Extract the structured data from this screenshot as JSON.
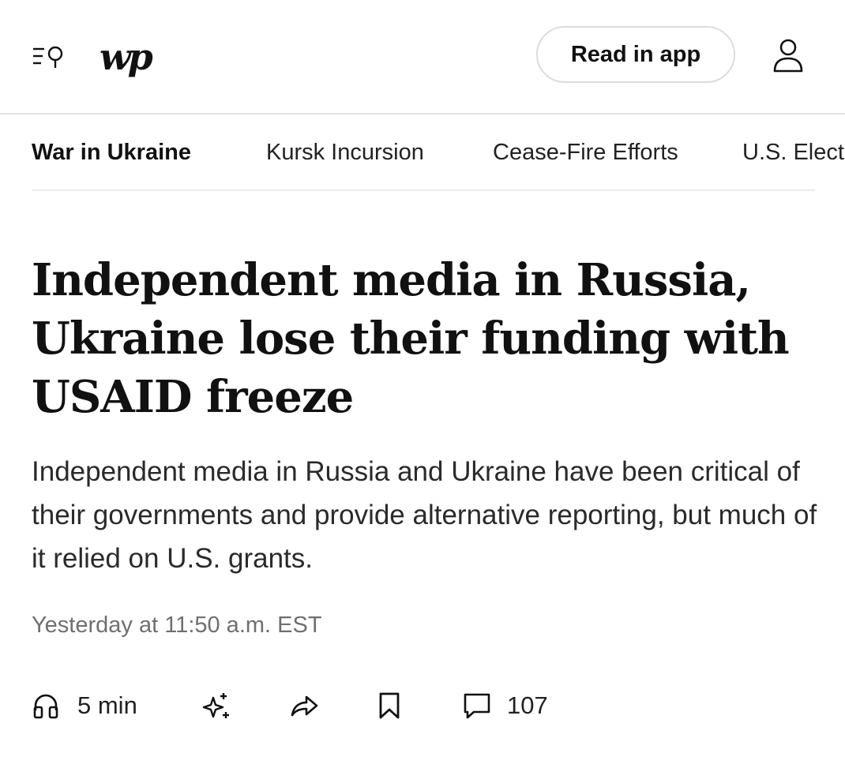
{
  "header": {
    "logo_text": "wp",
    "read_in_app_label": "Read in app",
    "icons": [
      "menu-search-icon",
      "user-account-icon"
    ]
  },
  "section_nav": {
    "items": [
      {
        "label": "War in Ukraine",
        "active": true
      },
      {
        "label": "Kursk Incursion",
        "active": false
      },
      {
        "label": "Cease-Fire Efforts",
        "active": false
      },
      {
        "label": "U.S. Elect",
        "active": false
      }
    ]
  },
  "article": {
    "headline": "Independent media in Russia, Ukraine lose their funding with USAID freeze",
    "dek": "Independent media in Russia and Ukraine have been critical of their governments and provide alternative reporting, but much of it relied on U.S. grants.",
    "timestamp": "Yesterday at 11:50 a.m. EST"
  },
  "action_bar": {
    "listen_label": "5 min",
    "comment_count": "107",
    "icons": [
      "headphones-icon",
      "sparkle-icon",
      "share-icon",
      "bookmark-icon",
      "comment-icon"
    ]
  }
}
